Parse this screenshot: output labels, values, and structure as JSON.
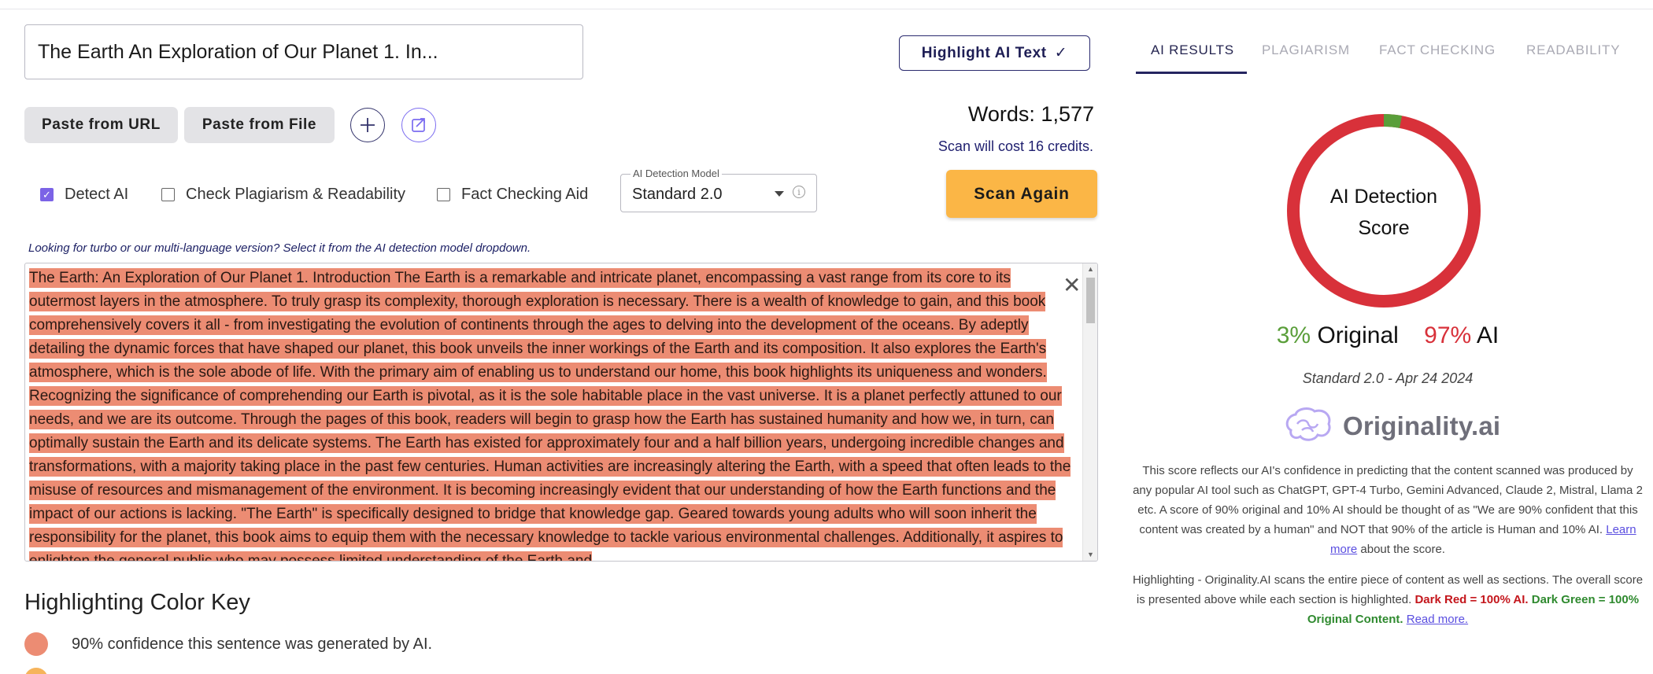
{
  "document": {
    "title_value": "The Earth An Exploration of Our Planet 1. In...",
    "highlight_button": "Highlight AI Text",
    "paste_url_button": "Paste from URL",
    "paste_file_button": "Paste from File",
    "words": "Words: 1,577",
    "cost": "Scan will cost 16 credits.",
    "options": {
      "detect_ai": "Detect AI",
      "detect_ai_checked": true,
      "plagiarism": "Check Plagiarism & Readability",
      "plagiarism_checked": false,
      "fact": "Fact Checking Aid",
      "fact_checked": false
    },
    "model_legend": "AI Detection Model",
    "model_value": "Standard 2.0",
    "scan_button": "Scan Again",
    "hint": "Looking for turbo or our multi-language version? Select it from the AI detection model dropdown.",
    "content": "The Earth: An Exploration of Our Planet 1. Introduction The Earth is a remarkable and intricate planet, encompassing a vast range from its core to its outermost layers in the atmosphere. To truly grasp its complexity, thorough exploration is necessary. There is a wealth of knowledge to gain, and this book comprehensively covers it all - from investigating the evolution of continents through the ages to delving into the development of the oceans. By adeptly detailing the dynamic forces that have shaped our planet, this book unveils the inner workings of the Earth and its composition. It also explores the Earth's atmosphere, which is the sole abode of life. With the primary aim of enabling us to understand our home, this book highlights its uniqueness and wonders. Recognizing the significance of comprehending our Earth is pivotal, as it is the sole habitable place in the vast universe. It is a planet perfectly attuned to our needs, and we are its outcome. Through the pages of this book, readers will begin to grasp how the Earth has sustained humanity and how we, in turn, can optimally sustain the Earth and its delicate systems. The Earth has existed for approximately four and a half billion years, undergoing incredible changes and transformations, with a majority taking place in the past few centuries. Human activities are increasingly altering the Earth, with a speed that often leads to the misuse of resources and mismanagement of the environment. It is becoming increasingly evident that our understanding of how the Earth functions and the impact of our actions is lacking. \"The Earth\" is specifically designed to bridge that knowledge gap. Geared towards young adults who will soon inherit the responsibility for the planet, this book aims to equip them with the necessary knowledge to tackle various environmental challenges. Additionally, it aspires to enlighten the general public who may possess limited understanding of the Earth and",
    "highlight_color": "#ec8c73"
  },
  "color_key": {
    "title": "Highlighting Color Key",
    "items": [
      {
        "label": "90% confidence this sentence was generated by AI.",
        "color": "#ec8c73"
      },
      {
        "label": "",
        "color": "#f6b45b"
      }
    ]
  },
  "results": {
    "tabs": [
      "AI RESULTS",
      "PLAGIARISM",
      "FACT CHECKING",
      "READABILITY"
    ],
    "active_tab": "AI RESULTS",
    "donut_label_line1": "AI Detection",
    "donut_label_line2": "Score",
    "original_pct": "3%",
    "original_label": "Original",
    "ai_pct": "97%",
    "ai_label": "AI",
    "original_fraction": 0.03,
    "ai_fraction": 0.97,
    "original_color": "#5a9e3a",
    "ai_color": "#d8313a",
    "model_date": "Standard 2.0 - Apr 24 2024",
    "brand": "Originality.ai",
    "explain_text": "This score reflects our AI's confidence in predicting that the content scanned was produced by any popular AI tool such as ChatGPT, GPT-4 Turbo, Gemini Advanced, Claude 2, Mistral, Llama 2 etc. A score of 90% original and 10% AI should be thought of as \"We are 90% confident that this content was created by a human\" and NOT that 90% of the article is Human and 10% AI.",
    "learn_more": "Learn more",
    "explain_tail": "about the score.",
    "highlight_text": "Highlighting - Originality.AI scans the entire piece of content as well as sections. The overall score is presented above while each section is highlighted.",
    "dark_red": "Dark Red = 100% AI.",
    "dark_green": "Dark Green = 100% Original Content.",
    "read_more": "Read more."
  }
}
